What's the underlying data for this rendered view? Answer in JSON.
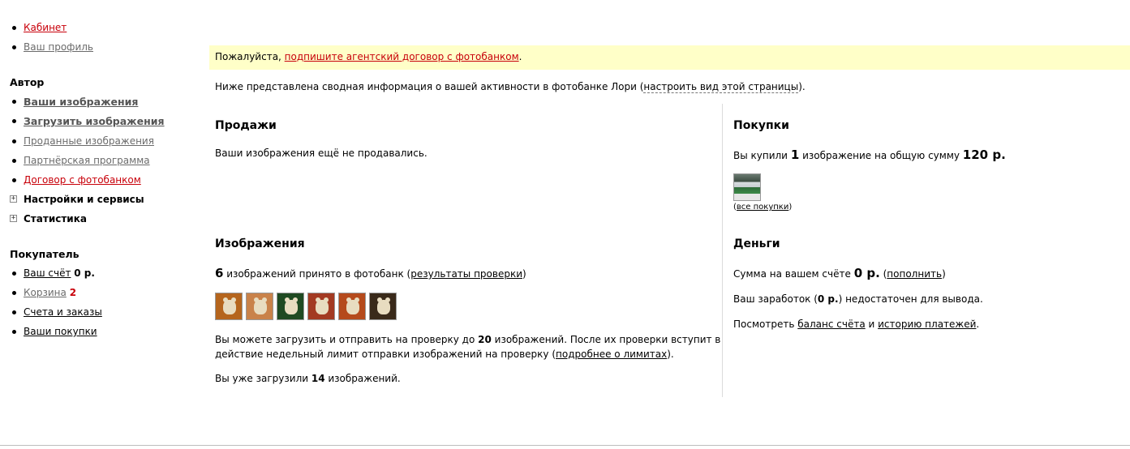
{
  "sidebar": {
    "top": [
      {
        "label": "Кабинет"
      },
      {
        "label": "Ваш профиль"
      }
    ],
    "author": {
      "heading": "Автор",
      "items": [
        {
          "label": "Ваши изображения"
        },
        {
          "label": "Загрузить изображения"
        },
        {
          "label": "Проданные изображения"
        },
        {
          "label": "Партнёрская программа"
        },
        {
          "label": "Договор с фотобанком"
        },
        {
          "label": "Настройки и сервисы"
        },
        {
          "label": "Статистика"
        }
      ]
    },
    "buyer": {
      "heading": "Покупатель",
      "items": [
        {
          "label": "Ваш счёт",
          "value": "0 р."
        },
        {
          "label": "Корзина",
          "value": "2"
        },
        {
          "label": "Счета и заказы"
        },
        {
          "label": "Ваши покупки"
        }
      ]
    }
  },
  "notice": {
    "prefix": "Пожалуйста, ",
    "link": "подпишите агентский договор с фотобанком",
    "suffix": "."
  },
  "intro": {
    "text": "Ниже представлена сводная информация о вашей активности в фотобанке Лори (",
    "link": "настроить вид этой страницы",
    "suffix": ")."
  },
  "sales": {
    "title": "Продажи",
    "text": "Ваши изображения ещё не продавались."
  },
  "purchases": {
    "title": "Покупки",
    "text1": "Вы купили ",
    "count": "1",
    "text2": " изображение на общую сумму ",
    "sum": "120 р.",
    "all_link": "все покупки",
    "open_paren": "(",
    "close_paren": ")"
  },
  "images": {
    "title": "Изображения",
    "count": "6",
    "text": " изображений принято в фотобанк (",
    "link": "результаты проверки",
    "suffix": ")",
    "thumbs": [
      {
        "bg": "#b5651d"
      },
      {
        "bg": "#c9824a"
      },
      {
        "bg": "#1f4a22"
      },
      {
        "bg": "#a33a22"
      },
      {
        "bg": "#b54a1c"
      },
      {
        "bg": "#3a2a1a"
      }
    ],
    "limit_line1_a": "Вы можете загрузить и отправить на проверку до ",
    "limit_num": "20",
    "limit_line1_b": " изображений. После их проверки вступит в",
    "limit_line2_a": "действие недельный лимит отправки изображений на проверку (",
    "limit_link": "подробнее о лимитах",
    "limit_line2_b": ").",
    "uploaded_a": "Вы уже загрузили ",
    "uploaded_num": "14",
    "uploaded_b": " изображений."
  },
  "money": {
    "title": "Деньги",
    "balance_a": "Сумма на вашем счёте ",
    "balance": "0 р.",
    "balance_b": " (",
    "topup_link": "пополнить",
    "balance_c": ")",
    "earn_a": "Ваш заработок (",
    "earn": "0 р.",
    "earn_b": ") недостаточен для вывода.",
    "view_a": "Посмотреть ",
    "balance_link": "баланс счёта",
    "view_and": " и ",
    "history_link": "историю платежей",
    "view_end": "."
  }
}
